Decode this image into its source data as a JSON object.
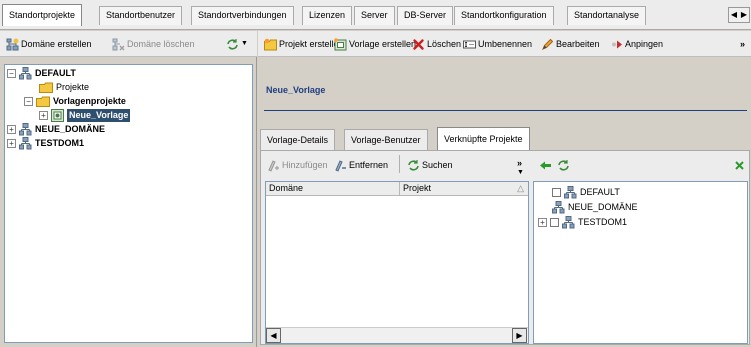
{
  "top_tabs": [
    {
      "label": "Standortprojekte",
      "active": true
    },
    {
      "label": "Standortbenutzer",
      "active": false
    },
    {
      "label": "Standortverbindungen",
      "active": false
    },
    {
      "label": "Lizenzen",
      "active": false
    },
    {
      "label": "Server",
      "active": false
    },
    {
      "label": "DB-Server",
      "active": false
    },
    {
      "label": "Standortkonfiguration",
      "active": false
    },
    {
      "label": "Standortanalyse",
      "active": false
    }
  ],
  "left_toolbar": {
    "create_domain": "Domäne erstellen",
    "delete_domain": "Domäne löschen"
  },
  "tree": {
    "items": [
      {
        "label": "DEFAULT"
      },
      {
        "label": "Projekte"
      },
      {
        "label": "Vorlagenprojekte"
      },
      {
        "label": "Neue_Vorlage"
      },
      {
        "label": "NEUE_DOMÄNE"
      },
      {
        "label": "TESTDOM1"
      }
    ]
  },
  "right_toolbar": {
    "create_project": "Projekt erstellen",
    "create_template": "Vorlage erstellen",
    "delete": "Löschen",
    "rename": "Umbenennen",
    "edit": "Bearbeiten",
    "pin": "Anpingen",
    "more": "»"
  },
  "template_title": "Neue_Vorlage",
  "sub_tabs": [
    {
      "label": "Vorlage-Details",
      "active": false
    },
    {
      "label": "Vorlage-Benutzer",
      "active": false
    },
    {
      "label": "Verknüpfte Projekte",
      "active": true
    }
  ],
  "linked_toolbar": {
    "add": "Hinzufügen",
    "remove": "Entfernen",
    "search": "Suchen",
    "more": "»"
  },
  "grid": {
    "columns": [
      "Domäne",
      "Projekt"
    ]
  },
  "picker_tree": {
    "items": [
      {
        "label": "DEFAULT"
      },
      {
        "label": "NEUE_DOMÄNE"
      },
      {
        "label": "TESTDOM1"
      }
    ]
  },
  "colors": {
    "accent": "#1f3f7f",
    "selection": "#2f4f6f",
    "delete_red": "#cc1f1f",
    "add_green": "#2a9a2a"
  }
}
